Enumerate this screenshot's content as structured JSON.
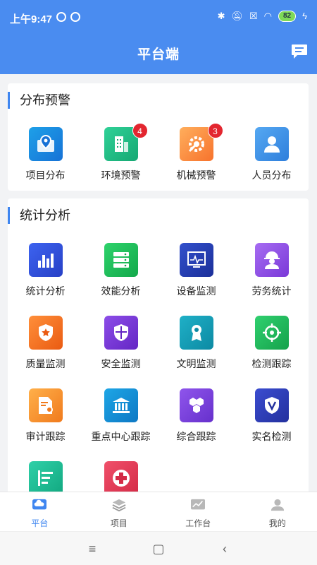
{
  "status": {
    "time": "上午9:47",
    "battery": "82"
  },
  "header": {
    "title": "平台端"
  },
  "warning": {
    "title": "分布预警",
    "items": [
      {
        "label": "项目分布",
        "icon": "map-pin-icon",
        "color1": "#1ea0e8",
        "color2": "#1672d6"
      },
      {
        "label": "环境预警",
        "icon": "building-icon",
        "color1": "#2fd197",
        "color2": "#16a873",
        "badge": "4"
      },
      {
        "label": "机械预警",
        "icon": "wrench-gear-icon",
        "color1": "#ffae5c",
        "color2": "#f7732d",
        "badge": "3"
      },
      {
        "label": "人员分布",
        "icon": "person-icon",
        "color1": "#55a8f2",
        "color2": "#2f7fdc"
      }
    ]
  },
  "stats": {
    "title": "统计分析",
    "items": [
      {
        "label": "统计分析",
        "icon": "bar-chart-icon",
        "color1": "#3d63f0",
        "color2": "#2740c6"
      },
      {
        "label": "效能分析",
        "icon": "server-icon",
        "color1": "#2ed36b",
        "color2": "#13a84b"
      },
      {
        "label": "设备监测",
        "icon": "monitor-icon",
        "color1": "#3250cc",
        "color2": "#1b2f99"
      },
      {
        "label": "劳务统计",
        "icon": "worker-icon",
        "color1": "#a66cf2",
        "color2": "#7a39d8"
      },
      {
        "label": "质量监测",
        "icon": "star-shield-icon",
        "color1": "#ff8f3a",
        "color2": "#ea5b12"
      },
      {
        "label": "安全监测",
        "icon": "shield-icon",
        "color1": "#8c4de8",
        "color2": "#6426c4"
      },
      {
        "label": "文明监测",
        "icon": "ribbon-icon",
        "color1": "#1fb0c7",
        "color2": "#0d8aa3"
      },
      {
        "label": "检测跟踪",
        "icon": "target-icon",
        "color1": "#30d06f",
        "color2": "#15a24b"
      },
      {
        "label": "审计跟踪",
        "icon": "doc-gear-icon",
        "color1": "#ffb04a",
        "color2": "#f07a1c"
      },
      {
        "label": "重点中心跟踪",
        "icon": "bank-icon",
        "color1": "#1ea6e6",
        "color2": "#0d78c4"
      },
      {
        "label": "综合跟踪",
        "icon": "hexagons-icon",
        "color1": "#8f55ec",
        "color2": "#6630cc"
      },
      {
        "label": "实名检测",
        "icon": "v-shield-icon",
        "color1": "#3b4dd0",
        "color2": "#23309e"
      },
      {
        "label": "",
        "icon": "list-icon",
        "color1": "#2fd0a8",
        "color2": "#12a880"
      },
      {
        "label": "",
        "icon": "plus-icon",
        "color1": "#f0506a",
        "color2": "#d42a46"
      }
    ]
  },
  "tabs": [
    {
      "label": "平台",
      "icon": "cloud-icon",
      "active": true
    },
    {
      "label": "项目",
      "icon": "layers-icon",
      "active": false
    },
    {
      "label": "工作台",
      "icon": "chart-icon",
      "active": false
    },
    {
      "label": "我的",
      "icon": "user-icon",
      "active": false
    }
  ]
}
